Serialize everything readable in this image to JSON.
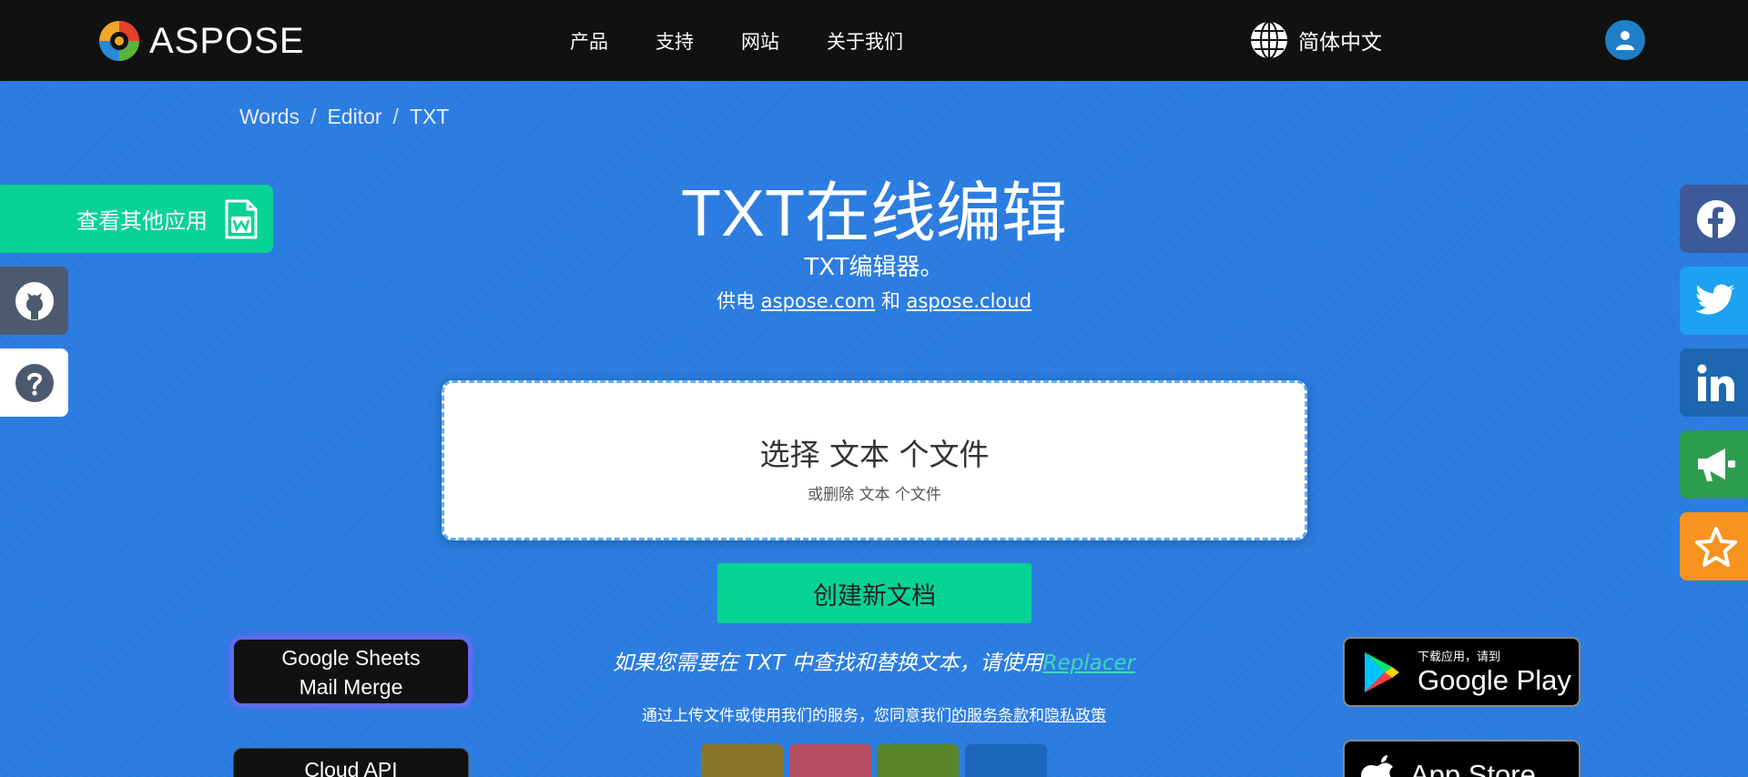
{
  "header": {
    "logo_text": "ASPOSE",
    "nav": [
      "产品",
      "支持",
      "网站",
      "关于我们"
    ],
    "language": "简体中文"
  },
  "breadcrumb": [
    "Words",
    "Editor",
    "TXT"
  ],
  "hero": {
    "title": "TXT在线编辑",
    "subtitle": "TXT编辑器。",
    "powered_prefix": "供电",
    "powered_link1": "aspose.com",
    "powered_and": "和",
    "powered_link2": "aspose.cloud"
  },
  "upload": {
    "main": "选择 文本 个文件",
    "sub": "或删除 文本 个文件"
  },
  "create_button": "创建新文档",
  "replacer": {
    "text": "如果您需要在 TXT 中查找和替换文本，请使用",
    "link": "Replacer"
  },
  "terms": {
    "prefix": "通过上传文件或使用我们的服务，您同意我们",
    "link1": "的服务条款",
    "and": "和",
    "link2": "隐私政策"
  },
  "left_panel": {
    "other_apps": "查看其他应用"
  },
  "promo": {
    "card1_line1": "Google Sheets",
    "card1_line2": "Mail Merge",
    "card2": "Cloud API"
  },
  "stores": {
    "gplay_small": "下载应用，请到",
    "gplay_big": "Google Play",
    "appstore_big": "App Store"
  },
  "colors": {
    "background": "#2b7ce0",
    "accent_green": "#07d394",
    "topbar": "#111111"
  },
  "icons": {
    "github": "github-icon",
    "help": "question-icon",
    "facebook": "facebook-icon",
    "twitter": "twitter-icon",
    "linkedin": "linkedin-icon",
    "announce": "megaphone-icon",
    "star": "star-icon"
  }
}
